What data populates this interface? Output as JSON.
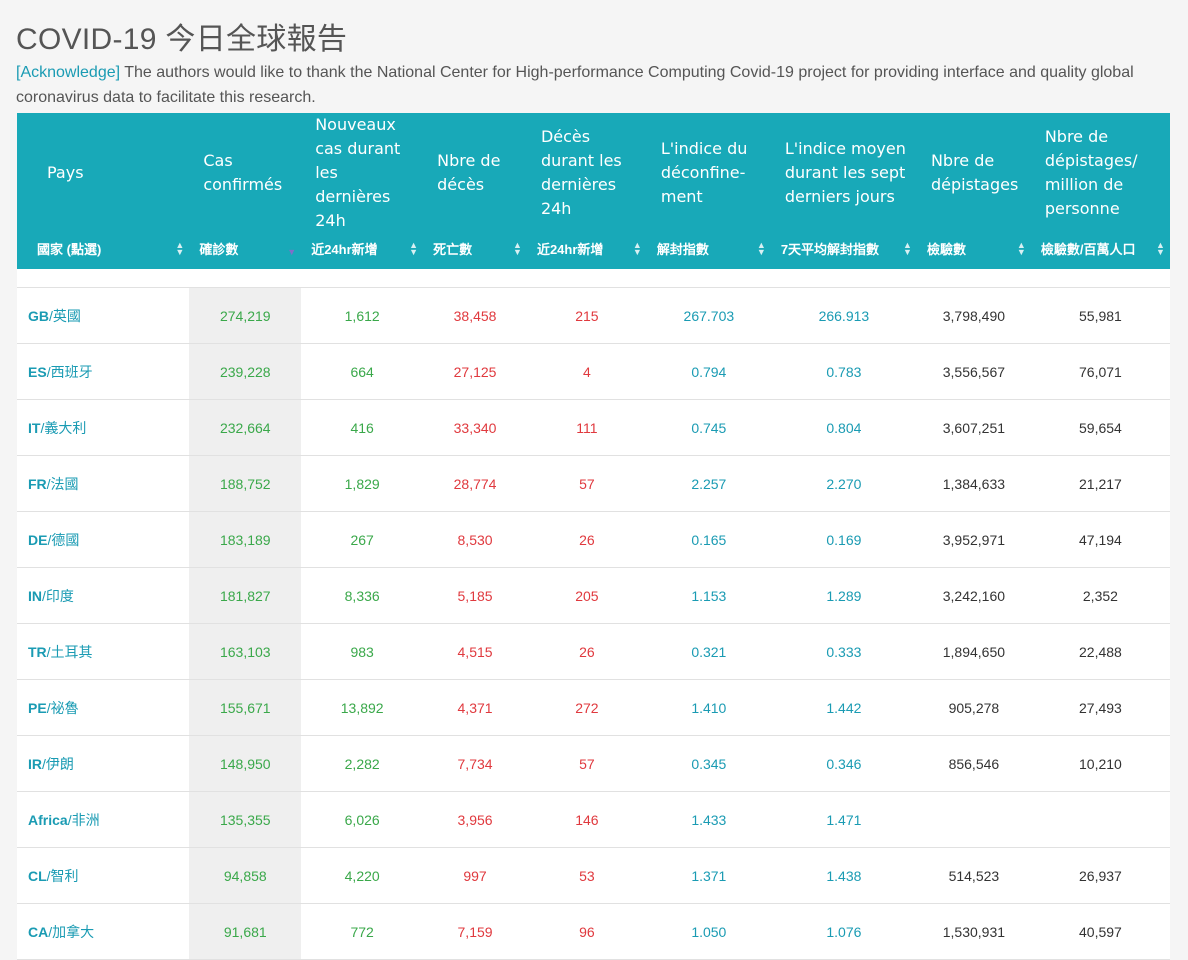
{
  "title": "COVID-19 今日全球報告",
  "acknowledge": {
    "tag": "[Acknowledge]",
    "text": " The authors would like to thank the National Center for High-performance Computing Covid-19 project for providing interface and quality global coronavirus data to facilitate this research."
  },
  "columns": [
    {
      "fr": "Pays",
      "zh": "國家 (點選)"
    },
    {
      "fr": "Cas confirmés",
      "zh": "確診數"
    },
    {
      "fr": "Nouveaux cas durant les dernières 24h",
      "zh": "近24hr新增"
    },
    {
      "fr": "Nbre de décès",
      "zh": "死亡數"
    },
    {
      "fr": "Décès durant les dernières 24h",
      "zh": "近24hr新增"
    },
    {
      "fr": "L'indice du déconfine-ment",
      "zh": "解封指數"
    },
    {
      "fr": "L'indice moyen durant les sept derniers jours",
      "zh": "7天平均解封指數"
    },
    {
      "fr": "Nbre de dépistages",
      "zh": "檢驗數"
    },
    {
      "fr": "Nbre de dépistages/ million de personne",
      "zh": "檢驗數/百萬人口"
    }
  ],
  "sort": {
    "sorted_column": "確診數",
    "direction": "descending"
  },
  "rows": [
    {
      "code": "GB",
      "name": "/英國",
      "confirmed": "274,219",
      "new_cases": "1,612",
      "deaths": "38,458",
      "new_deaths": "215",
      "index": "267.703",
      "index7": "266.913",
      "tests": "3,798,490",
      "tests_per_million": "55,981"
    },
    {
      "code": "ES",
      "name": "/西班牙",
      "confirmed": "239,228",
      "new_cases": "664",
      "deaths": "27,125",
      "new_deaths": "4",
      "index": "0.794",
      "index7": "0.783",
      "tests": "3,556,567",
      "tests_per_million": "76,071"
    },
    {
      "code": "IT",
      "name": "/義大利",
      "confirmed": "232,664",
      "new_cases": "416",
      "deaths": "33,340",
      "new_deaths": "111",
      "index": "0.745",
      "index7": "0.804",
      "tests": "3,607,251",
      "tests_per_million": "59,654"
    },
    {
      "code": "FR",
      "name": "/法國",
      "confirmed": "188,752",
      "new_cases": "1,829",
      "deaths": "28,774",
      "new_deaths": "57",
      "index": "2.257",
      "index7": "2.270",
      "tests": "1,384,633",
      "tests_per_million": "21,217"
    },
    {
      "code": "DE",
      "name": "/德國",
      "confirmed": "183,189",
      "new_cases": "267",
      "deaths": "8,530",
      "new_deaths": "26",
      "index": "0.165",
      "index7": "0.169",
      "tests": "3,952,971",
      "tests_per_million": "47,194"
    },
    {
      "code": "IN",
      "name": "/印度",
      "confirmed": "181,827",
      "new_cases": "8,336",
      "deaths": "5,185",
      "new_deaths": "205",
      "index": "1.153",
      "index7": "1.289",
      "tests": "3,242,160",
      "tests_per_million": "2,352"
    },
    {
      "code": "TR",
      "name": "/土耳其",
      "confirmed": "163,103",
      "new_cases": "983",
      "deaths": "4,515",
      "new_deaths": "26",
      "index": "0.321",
      "index7": "0.333",
      "tests": "1,894,650",
      "tests_per_million": "22,488"
    },
    {
      "code": "PE",
      "name": "/祕魯",
      "confirmed": "155,671",
      "new_cases": "13,892",
      "deaths": "4,371",
      "new_deaths": "272",
      "index": "1.410",
      "index7": "1.442",
      "tests": "905,278",
      "tests_per_million": "27,493"
    },
    {
      "code": "IR",
      "name": "/伊朗",
      "confirmed": "148,950",
      "new_cases": "2,282",
      "deaths": "7,734",
      "new_deaths": "57",
      "index": "0.345",
      "index7": "0.346",
      "tests": "856,546",
      "tests_per_million": "10,210"
    },
    {
      "code": "Africa",
      "name": "/非洲",
      "confirmed": "135,355",
      "new_cases": "6,026",
      "deaths": "3,956",
      "new_deaths": "146",
      "index": "1.433",
      "index7": "1.471",
      "tests": "",
      "tests_per_million": ""
    },
    {
      "code": "CL",
      "name": "/智利",
      "confirmed": "94,858",
      "new_cases": "4,220",
      "deaths": "997",
      "new_deaths": "53",
      "index": "1.371",
      "index7": "1.438",
      "tests": "514,523",
      "tests_per_million": "26,937"
    },
    {
      "code": "CA",
      "name": "/加拿大",
      "confirmed": "91,681",
      "new_cases": "772",
      "deaths": "7,159",
      "new_deaths": "96",
      "index": "1.050",
      "index7": "1.076",
      "tests": "1,530,931",
      "tests_per_million": "40,597"
    }
  ],
  "colors": {
    "header": "#18a9b8",
    "link": "#1a9bb3",
    "positive": "#3aa84a",
    "negative": "#e0393e"
  }
}
